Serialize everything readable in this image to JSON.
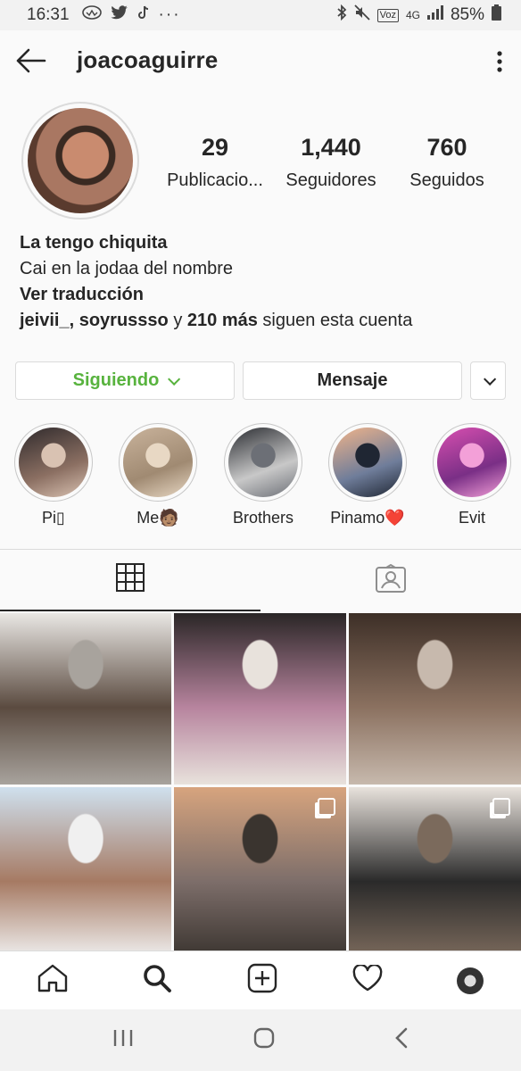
{
  "status_bar": {
    "time": "16:31",
    "battery": "85%",
    "volte": "Voz\n4G",
    "network": "4G"
  },
  "header": {
    "username": "joacoaguirre"
  },
  "profile": {
    "stats": [
      {
        "value": "29",
        "label": "Publicacio..."
      },
      {
        "value": "1,440",
        "label": "Seguidores"
      },
      {
        "value": "760",
        "label": "Seguidos"
      }
    ],
    "bio_line1": "La tengo chiquita",
    "bio_line2": "Cai en la jodaa del nombre",
    "translate": "Ver traducción",
    "followed_by_names": "jeivii_, soyrussso",
    "followed_by_y": "y",
    "followed_by_more": "210 más",
    "followed_by_suffix": "siguen esta cuenta"
  },
  "actions": {
    "following_label": "Siguiendo",
    "message_label": "Mensaje"
  },
  "highlights": [
    {
      "label": "Pi▯",
      "colors": [
        "#2f2a2c",
        "#8b6f62",
        "#d9c2b2"
      ]
    },
    {
      "label": "Me🧑🏽",
      "colors": [
        "#c9b39c",
        "#a08a72",
        "#e8d8c4"
      ]
    },
    {
      "label": "Brothers",
      "colors": [
        "#2a2c31",
        "#c8c8c8",
        "#6c6f76"
      ]
    },
    {
      "label": "Pinamo❤️",
      "colors": [
        "#f1b48a",
        "#6f7d9a",
        "#1f2633"
      ]
    },
    {
      "label": "Evit",
      "colors": [
        "#d84fb0",
        "#7a2f86",
        "#f3a0d8"
      ]
    }
  ],
  "grid_posts": [
    {
      "colors": [
        "#e9e7e4",
        "#5b4b40",
        "#a8a39d"
      ],
      "multi": false
    },
    {
      "colors": [
        "#2a2626",
        "#b7849e",
        "#e8e2dc"
      ],
      "multi": false
    },
    {
      "colors": [
        "#3d2f27",
        "#8b7160",
        "#c7b9ad"
      ],
      "multi": false
    },
    {
      "colors": [
        "#cfe0ee",
        "#a67a63",
        "#f0f0f0"
      ],
      "multi": false
    },
    {
      "colors": [
        "#d7a47e",
        "#7d6e6a",
        "#3a342f"
      ],
      "multi": true
    },
    {
      "colors": [
        "#e8e2dc",
        "#2a2a2a",
        "#7b6a5c"
      ],
      "multi": true
    }
  ],
  "colors": {
    "following_green": "#58b33e",
    "border": "#dbdbdb",
    "text": "#262626"
  }
}
